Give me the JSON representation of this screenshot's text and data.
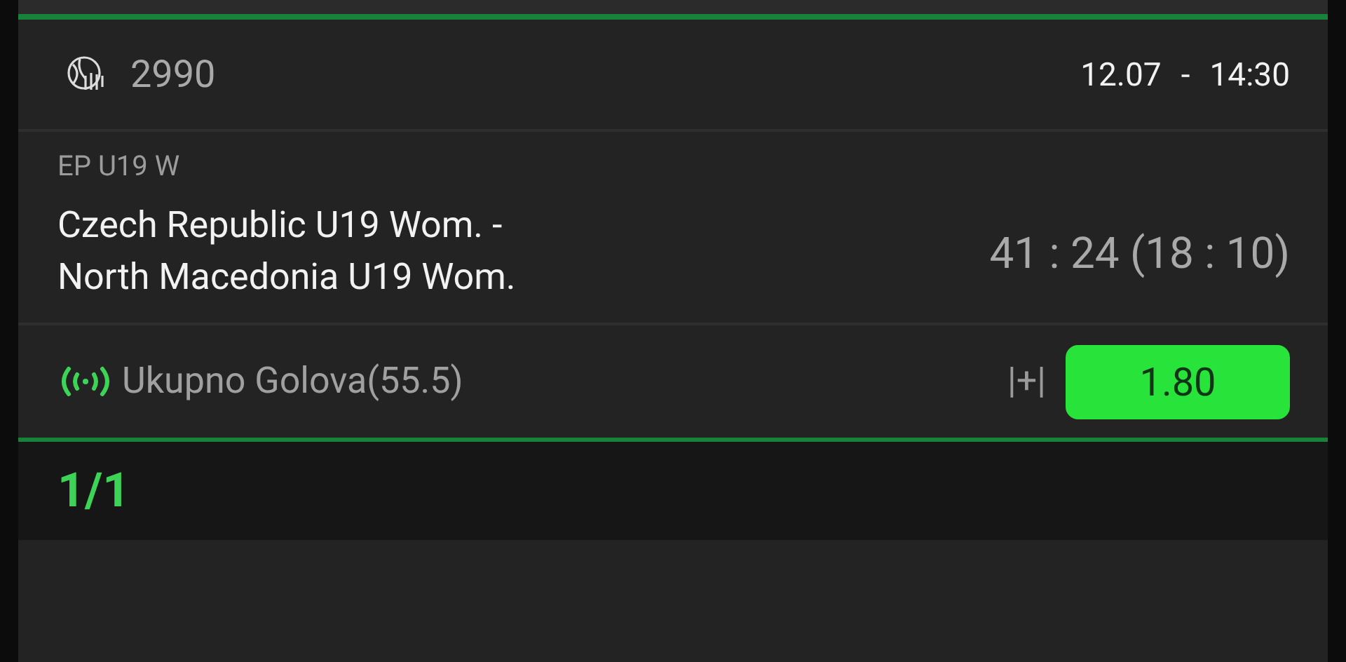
{
  "event": {
    "code": "2990",
    "date": "12.07",
    "separator": "-",
    "time": "14:30"
  },
  "league": "EP U19 W",
  "match": {
    "teams": [
      "Czech Republic U19 Wom. -",
      "North Macedonia U19 Wom."
    ],
    "score": "41 : 24 (18 : 10)"
  },
  "bet": {
    "live": true,
    "market": "Ukupno Golova(55.5)",
    "pick": "|+|",
    "odd": "1.80"
  },
  "footer": {
    "count": "1/1"
  }
}
